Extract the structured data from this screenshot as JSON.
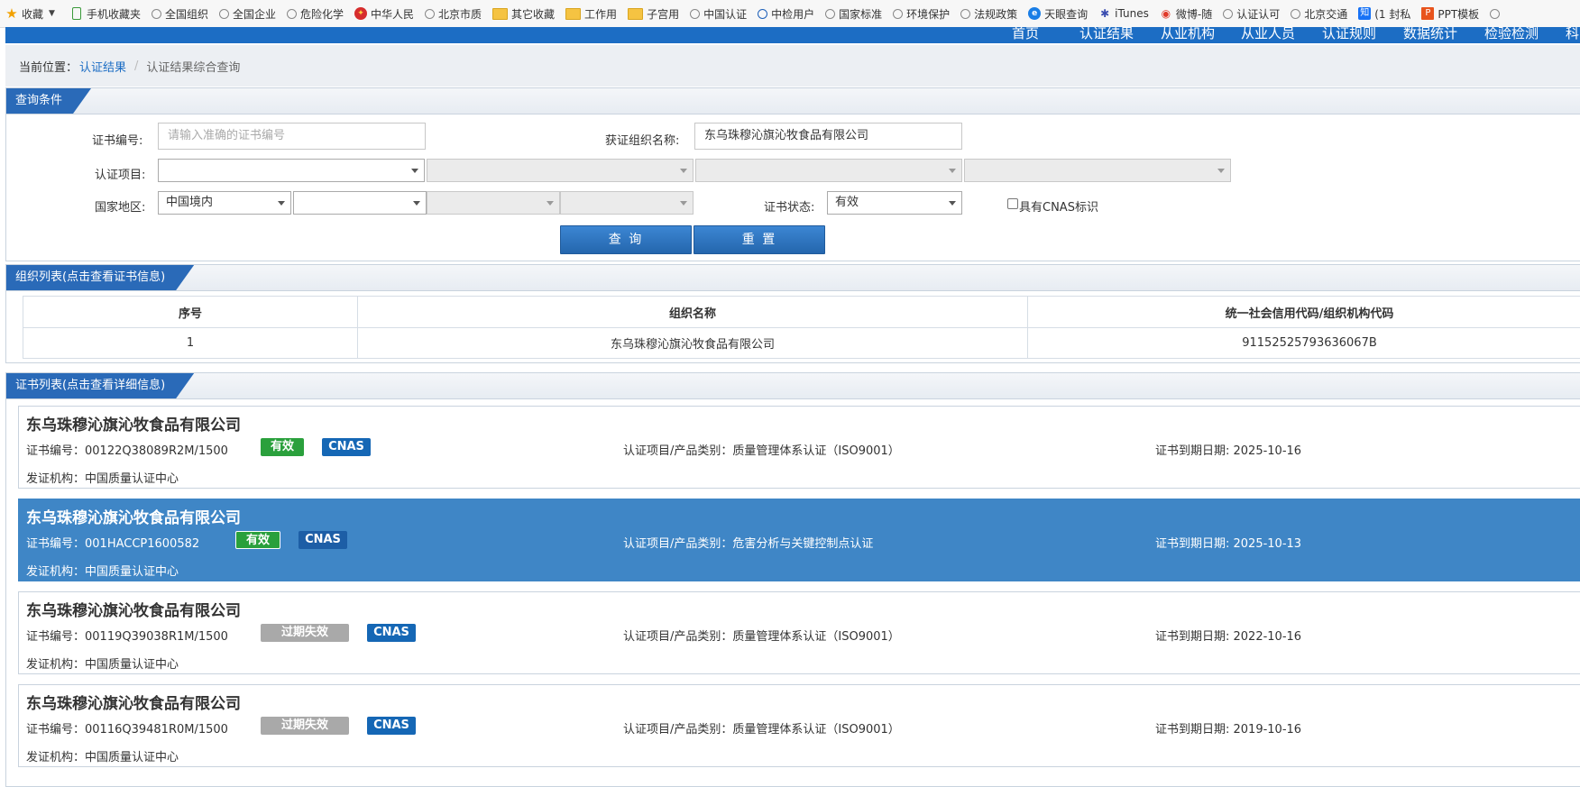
{
  "bookmarks": [
    {
      "label": "收藏",
      "icon": "star-icon"
    },
    {
      "label": "手机收藏夹",
      "icon": "phone-icon"
    },
    {
      "label": "全国组织",
      "icon": "globe-icon"
    },
    {
      "label": "全国企业",
      "icon": "globe-icon"
    },
    {
      "label": "危险化学",
      "icon": "globe-icon"
    },
    {
      "label": "中华人民",
      "icon": "emblem-icon"
    },
    {
      "label": "北京市质",
      "icon": "globe-icon"
    },
    {
      "label": "其它收藏",
      "icon": "folder-icon"
    },
    {
      "label": "工作用",
      "icon": "folder-icon"
    },
    {
      "label": "子宫用",
      "icon": "folder-icon"
    },
    {
      "label": "中国认证",
      "icon": "globe-icon"
    },
    {
      "label": "中检用户",
      "icon": "play-icon"
    },
    {
      "label": "国家标准",
      "icon": "globe-icon"
    },
    {
      "label": "环境保护",
      "icon": "globe-icon"
    },
    {
      "label": "法规政策",
      "icon": "globe-icon"
    },
    {
      "label": "天眼查询",
      "icon": "eye-icon"
    },
    {
      "label": "iTunes",
      "icon": "bug-icon"
    },
    {
      "label": "微博-随",
      "icon": "weibo-icon"
    },
    {
      "label": "认证认可",
      "icon": "globe-icon"
    },
    {
      "label": "北京交通",
      "icon": "globe-icon"
    },
    {
      "label": "(1 封私",
      "icon": "zhihu-icon"
    },
    {
      "label": "PPT模板",
      "icon": "ppt-icon"
    }
  ],
  "topnav": [
    "首页",
    "认证结果",
    "从业机构",
    "从业人员",
    "认证规则",
    "数据统计",
    "检验检测",
    "科"
  ],
  "breadcrumb": {
    "prefix": "当前位置：",
    "link": "认证结果",
    "current": "认证结果综合查询"
  },
  "query": {
    "title": "查询条件",
    "cert_no_label": "证书编号:",
    "cert_no_placeholder": "请输入准确的证书编号",
    "org_label": "获证组织名称:",
    "org_value": "东乌珠穆沁旗沁牧食品有限公司",
    "project_label": "认证项目:",
    "region_label": "国家地区:",
    "region_value": "中国境内",
    "status_label": "证书状态:",
    "status_value": "有效",
    "cnas_label": "具有CNAS标识",
    "search_button": "查 询",
    "reset_button": "重 置"
  },
  "org_list": {
    "title": "组织列表(点击查看证书信息)",
    "headers": [
      "序号",
      "组织名称",
      "统一社会信用代码/组织机构代码"
    ],
    "rows": [
      [
        "1",
        "东乌珠穆沁旗沁牧食品有限公司",
        "91152525793636067B"
      ]
    ]
  },
  "cert_list": {
    "title": "证书列表(点击查看详细信息)",
    "cards": [
      {
        "org": "东乌珠穆沁旗沁牧食品有限公司",
        "cert_no": "证书编号：00122Q38089R2M/1500",
        "status": "有效",
        "cnas": "CNAS",
        "project": "认证项目/产品类别：质量管理体系认证（ISO9001）",
        "expire": "证书到期日期: 2025-10-16",
        "issuer": "发证机构：中国质量认证中心"
      },
      {
        "org": "东乌珠穆沁旗沁牧食品有限公司",
        "cert_no": "证书编号：001HACCP1600582",
        "status": "有效",
        "cnas": "CNAS",
        "project": "认证项目/产品类别：危害分析与关键控制点认证",
        "expire": "证书到期日期: 2025-10-13",
        "issuer": "发证机构：中国质量认证中心"
      },
      {
        "org": "东乌珠穆沁旗沁牧食品有限公司",
        "cert_no": "证书编号：00119Q39038R1M/1500",
        "status": "过期失效",
        "cnas": "CNAS",
        "project": "认证项目/产品类别：质量管理体系认证（ISO9001）",
        "expire": "证书到期日期: 2022-10-16",
        "issuer": "发证机构：中国质量认证中心"
      },
      {
        "org": "东乌珠穆沁旗沁牧食品有限公司",
        "cert_no": "证书编号：00116Q39481R0M/1500",
        "status": "过期失效",
        "cnas": "CNAS",
        "project": "认证项目/产品类别：质量管理体系认证（ISO9001）",
        "expire": "证书到期日期: 2019-10-16",
        "issuer": "发证机构：中国质量认证中心"
      }
    ]
  }
}
